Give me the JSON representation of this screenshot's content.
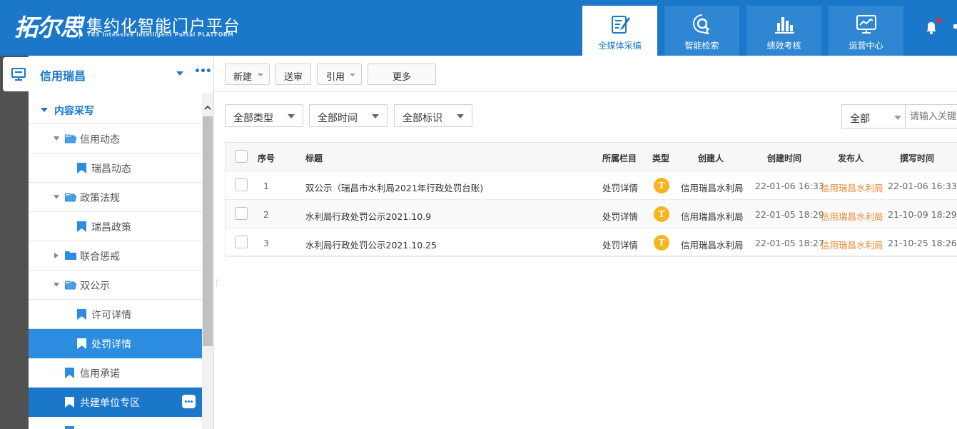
{
  "header": {
    "logo_mark": "拓尔思",
    "title": "集约化智能门户平台",
    "subtitle": "TRS Intensive Intelligent Portal PLATFORM",
    "tabs": [
      {
        "label": "全媒体采编",
        "icon": "pen-note-icon",
        "active": true
      },
      {
        "label": "智能检索",
        "icon": "search-chat-icon",
        "active": false
      },
      {
        "label": "绩效考核",
        "icon": "bar-chart-icon",
        "active": false
      },
      {
        "label": "运营中心",
        "icon": "monitor-chart-icon",
        "active": false
      }
    ],
    "brand_color": "#1a77c9"
  },
  "site": {
    "name": "信用瑞昌",
    "more": "•••"
  },
  "tree": {
    "root": "内容采写",
    "items": [
      {
        "label": "信用动态"
      },
      {
        "label": "瑞昌动态"
      },
      {
        "label": "政策法规"
      },
      {
        "label": "瑞昌政策"
      },
      {
        "label": "联合惩戒"
      },
      {
        "label": "双公示"
      },
      {
        "label": "许可详情"
      },
      {
        "label": "处罚详情"
      },
      {
        "label": "信用承诺"
      },
      {
        "label": "共建单位专区"
      }
    ]
  },
  "toolbar": {
    "new": "新建",
    "review": "送审",
    "quote": "引用",
    "more": "更多"
  },
  "filters": {
    "type": "全部类型",
    "time": "全部时间",
    "tag": "全部标识",
    "scope": "全部",
    "search_placeholder": "请输入关键"
  },
  "table": {
    "headers": [
      "序号",
      "标题",
      "所属栏目",
      "类型",
      "创建人",
      "创建时间",
      "发布人",
      "撰写时间"
    ],
    "rows": [
      {
        "no": "1",
        "title": "双公示（瑞昌市水利局2021年行政处罚台账)",
        "column": "处罚详情",
        "type": "T",
        "creator": "信用瑞昌水利局",
        "created": "22-01-06 16:33",
        "publisher": "信用瑞昌水利局",
        "written": "22-01-06 16:33"
      },
      {
        "no": "2",
        "title": "水利局行政处罚公示2021.10.9",
        "column": "处罚详情",
        "type": "T",
        "creator": "信用瑞昌水利局",
        "created": "22-01-05 18:29",
        "publisher": "信用瑞昌水利局",
        "written": "21-10-09 18:29"
      },
      {
        "no": "3",
        "title": "水利局行政处罚公示2021.10.25",
        "column": "处罚详情",
        "type": "T",
        "creator": "信用瑞昌水利局",
        "created": "22-01-05 18:27",
        "publisher": "信用瑞昌水利局",
        "written": "21-10-25 18:26"
      }
    ]
  }
}
